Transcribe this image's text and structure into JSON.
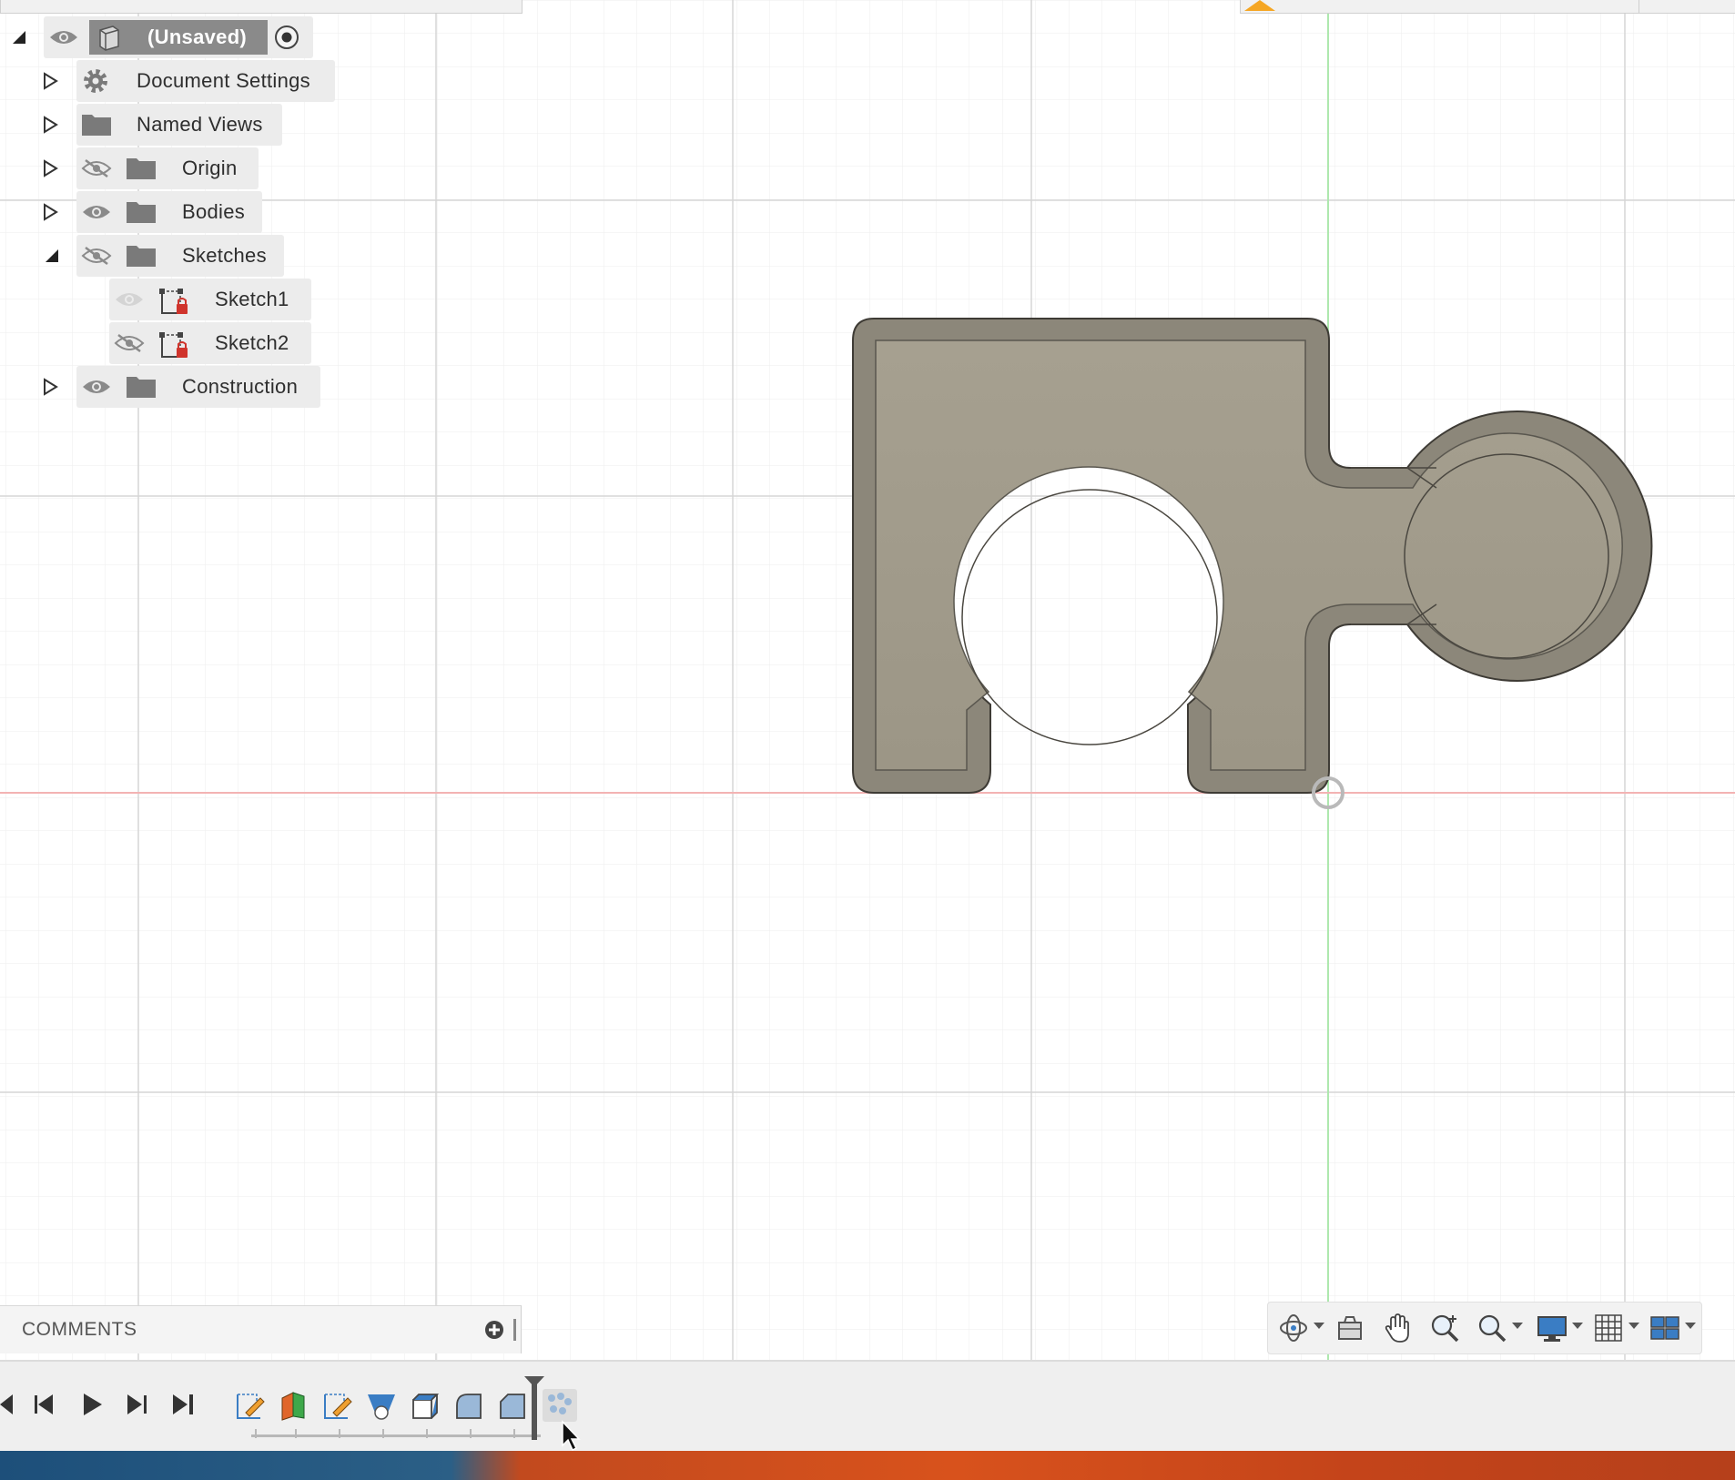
{
  "browser": {
    "root": {
      "label": "(Unsaved)"
    },
    "items": [
      {
        "label": "Document Settings"
      },
      {
        "label": "Named Views"
      },
      {
        "label": "Origin"
      },
      {
        "label": "Bodies"
      },
      {
        "label": "Sketches"
      },
      {
        "label": "Sketch1"
      },
      {
        "label": "Sketch2"
      },
      {
        "label": "Construction"
      }
    ]
  },
  "comments": {
    "title": "COMMENTS"
  },
  "icons": {
    "visible": "eye-icon",
    "hidden": "eye-slash-icon",
    "folder": "folder-icon",
    "settings": "gear-icon",
    "sketch": "sketch-icon",
    "component": "component-icon",
    "active": "radio-icon"
  },
  "colors": {
    "body_fill": "#a29c8d",
    "body_edge": "#6e6a60",
    "x_axis": "#f2a0a0",
    "y_axis": "#9fe09f",
    "grid": "#dcdcdc"
  }
}
